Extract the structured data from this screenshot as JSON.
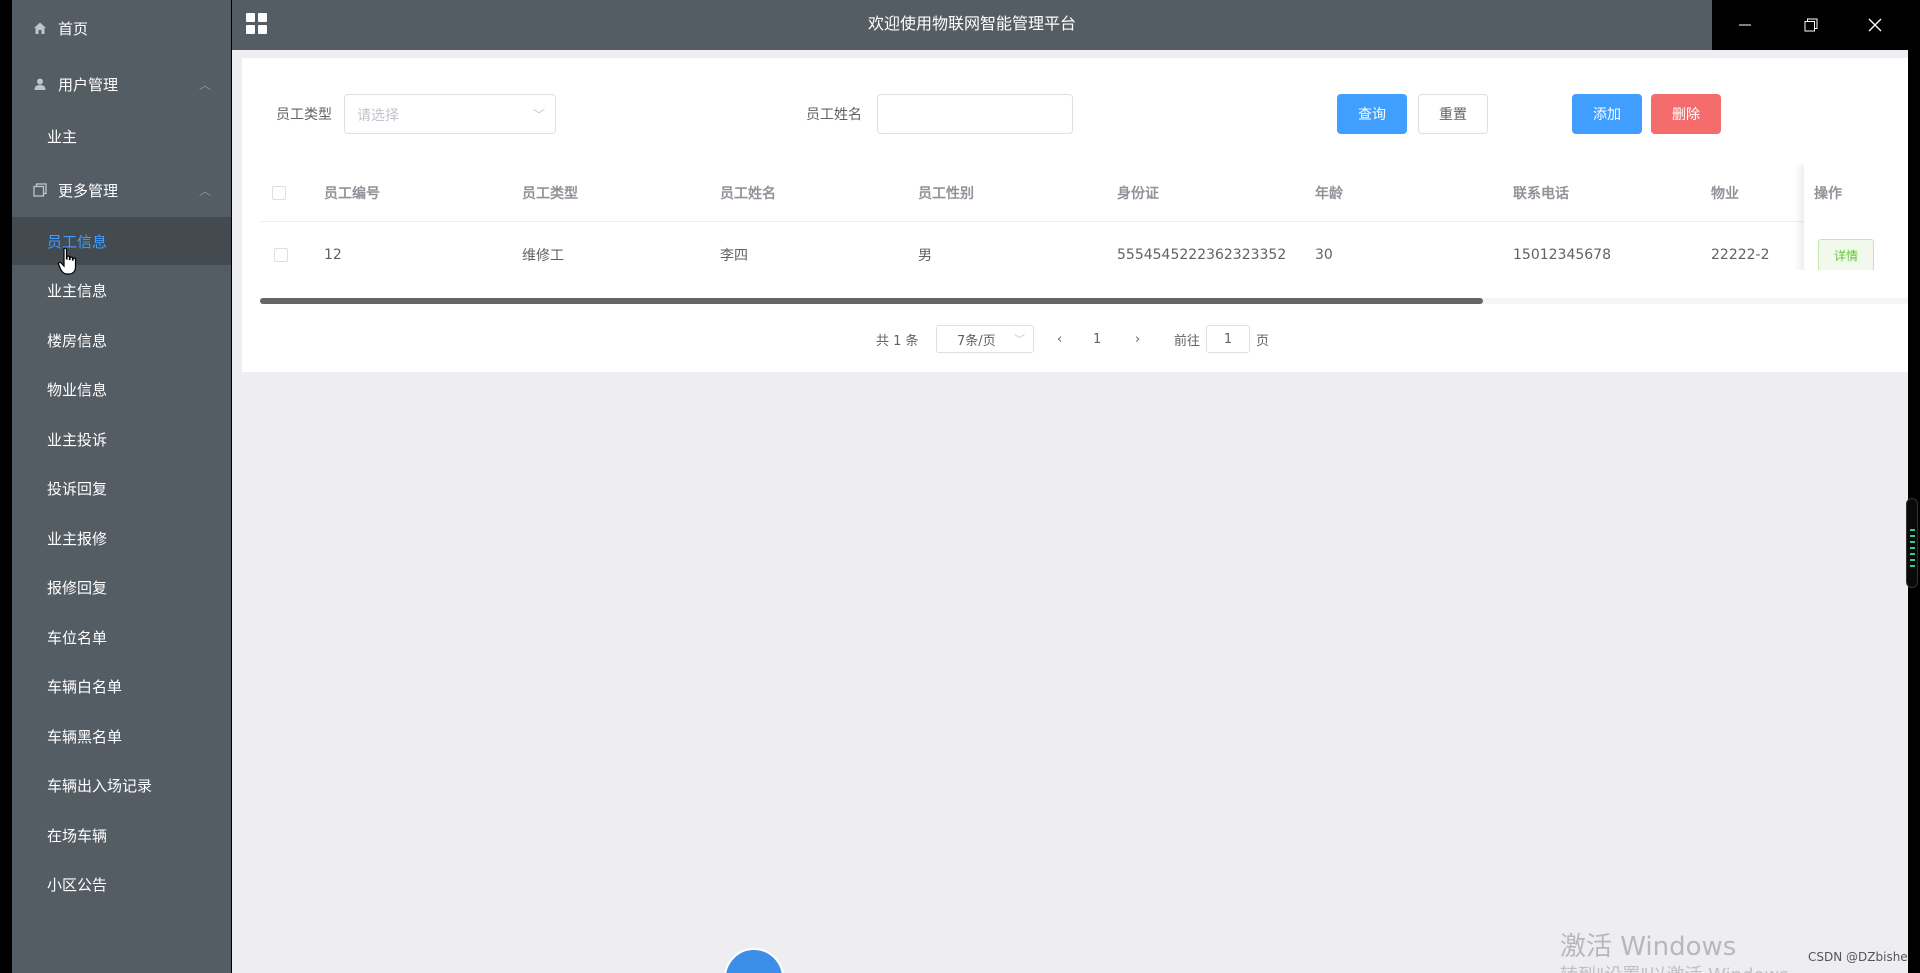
{
  "sidebar": {
    "home": "首页",
    "user_mgmt": "用户管理",
    "user_items": [
      "业主"
    ],
    "more_mgmt": "更多管理",
    "more_items": [
      "员工信息",
      "业主信息",
      "楼房信息",
      "物业信息",
      "业主投诉",
      "投诉回复",
      "业主报修",
      "报修回复",
      "车位名单",
      "车辆白名单",
      "车辆黑名单",
      "车辆出入场记录",
      "在场车辆",
      "小区公告"
    ],
    "active_item": "员工信息"
  },
  "topbar": {
    "title": "欢迎使用物联网智能管理平台"
  },
  "search": {
    "type_label": "员工类型",
    "type_placeholder": "请选择",
    "name_label": "员工姓名",
    "name_value": "",
    "query_button": "查询",
    "reset_button": "重置",
    "add_button": "添加",
    "delete_button": "删除"
  },
  "table": {
    "columns": [
      "员工编号",
      "员工类型",
      "员工姓名",
      "员工性别",
      "身份证",
      "年龄",
      "联系电话",
      "物业",
      "操作"
    ],
    "rows": [
      {
        "id": "12",
        "type": "维修工",
        "name": "李四",
        "gender": "男",
        "idcard": "5554545222362323352",
        "age": "30",
        "phone": "15012345678",
        "property": "22222-2",
        "action": "详情"
      }
    ]
  },
  "pagination": {
    "total": "共 1 条",
    "page_size": "7条/页",
    "current_page": "1",
    "goto_label": "前往",
    "goto_value": "1",
    "page_suffix": "页"
  },
  "overlay": {
    "watermark_line1": "激活 Windows",
    "watermark_line2": "转到\"设置\"以激活 Windows。",
    "csdn": "CSDN @DZbishe"
  },
  "colors": {
    "sidebar_bg": "#545c64",
    "accent": "#409eff",
    "danger": "#f56c6c",
    "success": "#67c23a"
  }
}
